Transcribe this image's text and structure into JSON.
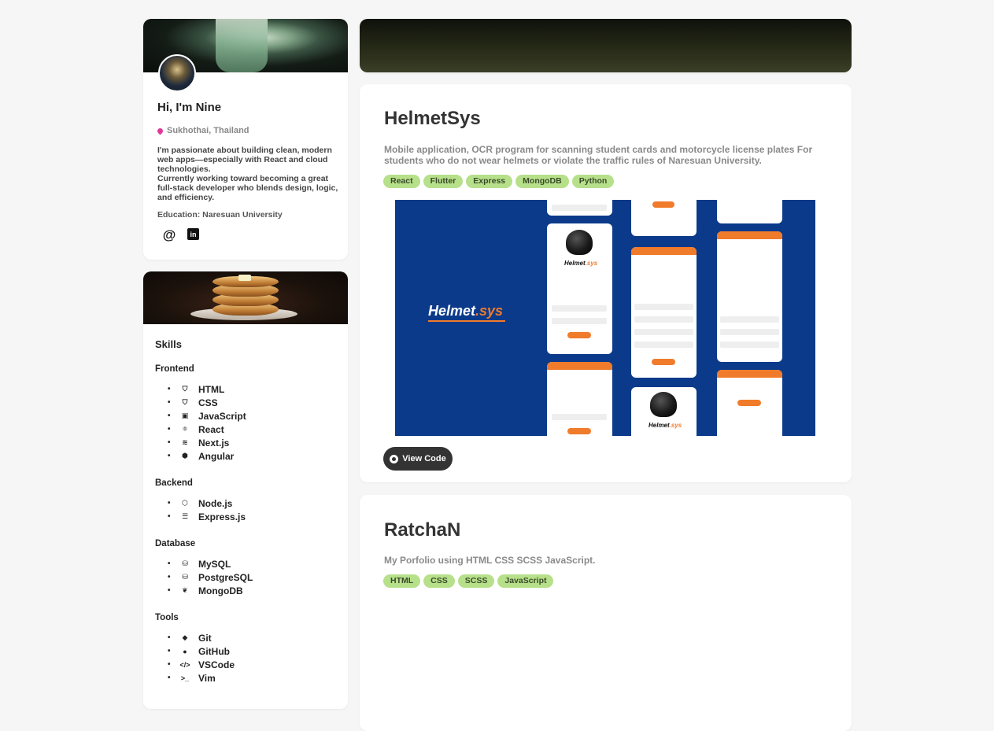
{
  "profile": {
    "name": "Hi, I'm Nine",
    "location": "Sukhothai, Thailand",
    "bio": "I'm passionate about building clean, modern\nweb apps—especially with React and cloud\ntechnologies.\nCurrently working toward becoming a great\nfull-stack developer who blends design, logic,\nand efficiency.",
    "education": "Education: Naresuan University",
    "socials": [
      {
        "icon": "at-icon",
        "glyph": "@"
      },
      {
        "icon": "linkedin-icon",
        "glyph": "in"
      }
    ]
  },
  "skills": {
    "title": "Skills",
    "sections": [
      {
        "heading": "Frontend",
        "items": [
          {
            "label": "HTML",
            "icon": "html5-icon"
          },
          {
            "label": "CSS",
            "icon": "css3-icon"
          },
          {
            "label": "JavaScript",
            "icon": "javascript-icon"
          },
          {
            "label": "React",
            "icon": "react-icon"
          },
          {
            "label": "Next.js",
            "icon": "nextjs-icon"
          },
          {
            "label": "Angular",
            "icon": "angular-icon"
          }
        ]
      },
      {
        "heading": "Backend",
        "items": [
          {
            "label": "Node.js",
            "icon": "nodejs-icon"
          },
          {
            "label": "Express.js",
            "icon": "express-icon"
          }
        ]
      },
      {
        "heading": "Database",
        "items": [
          {
            "label": "MySQL",
            "icon": "database-icon"
          },
          {
            "label": "PostgreSQL",
            "icon": "database-icon"
          },
          {
            "label": "MongoDB",
            "icon": "leaf-icon"
          }
        ]
      },
      {
        "heading": "Tools",
        "items": [
          {
            "label": "Git",
            "icon": "git-icon"
          },
          {
            "label": "GitHub",
            "icon": "github-icon"
          },
          {
            "label": "VSCode",
            "icon": "code-icon"
          },
          {
            "label": "Vim",
            "icon": "terminal-icon"
          }
        ]
      }
    ]
  },
  "projects": [
    {
      "title": "HelmetSys",
      "description": "Mobile application, OCR program for scanning student cards and motorcycle license plates For students who do not wear helmets or violate the traffic rules of Naresuan University.",
      "tags": [
        "React",
        "Flutter",
        "Express",
        "MongoDB",
        "Python"
      ],
      "screenshot_logo_main": "Helmet",
      "screenshot_logo_accent": ".sys",
      "view_code_label": "View Code"
    },
    {
      "title": "RatchaN",
      "description": "My Porfolio using HTML CSS SCSS JavaScript.",
      "tags": [
        "HTML",
        "CSS",
        "SCSS",
        "JavaScript"
      ]
    }
  ],
  "colors": {
    "tag_bg": "#b6e08a",
    "accent_orange": "#f07b2b",
    "screenshot_bg": "#0b3a8a",
    "button_bg": "#333333"
  }
}
